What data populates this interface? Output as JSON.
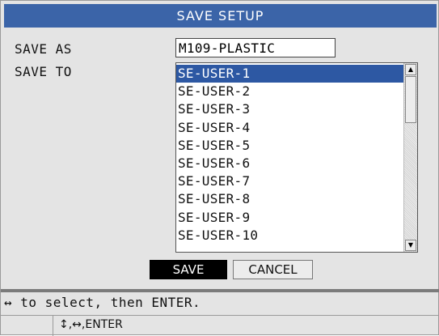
{
  "title": "SAVE SETUP",
  "fields": {
    "save_as_label": "SAVE AS",
    "save_as_value": "M109-PLASTIC",
    "save_to_label": "SAVE TO"
  },
  "list": {
    "items": [
      "SE-USER-1",
      "SE-USER-2",
      "SE-USER-3",
      "SE-USER-4",
      "SE-USER-5",
      "SE-USER-6",
      "SE-USER-7",
      "SE-USER-8",
      "SE-USER-9",
      "SE-USER-10"
    ],
    "selected": "SE-USER-1"
  },
  "scroll": {
    "up_icon": "arrow-up-icon",
    "down_icon": "arrow-down-icon"
  },
  "buttons": {
    "save": "SAVE",
    "cancel": "CANCEL"
  },
  "help": {
    "line": "↔ to select, then ENTER.",
    "keys": "↕,↔,ENTER"
  },
  "colors": {
    "title_bar": "#3b64a8",
    "selection": "#2d58a3",
    "background": "#e4e4e4"
  }
}
